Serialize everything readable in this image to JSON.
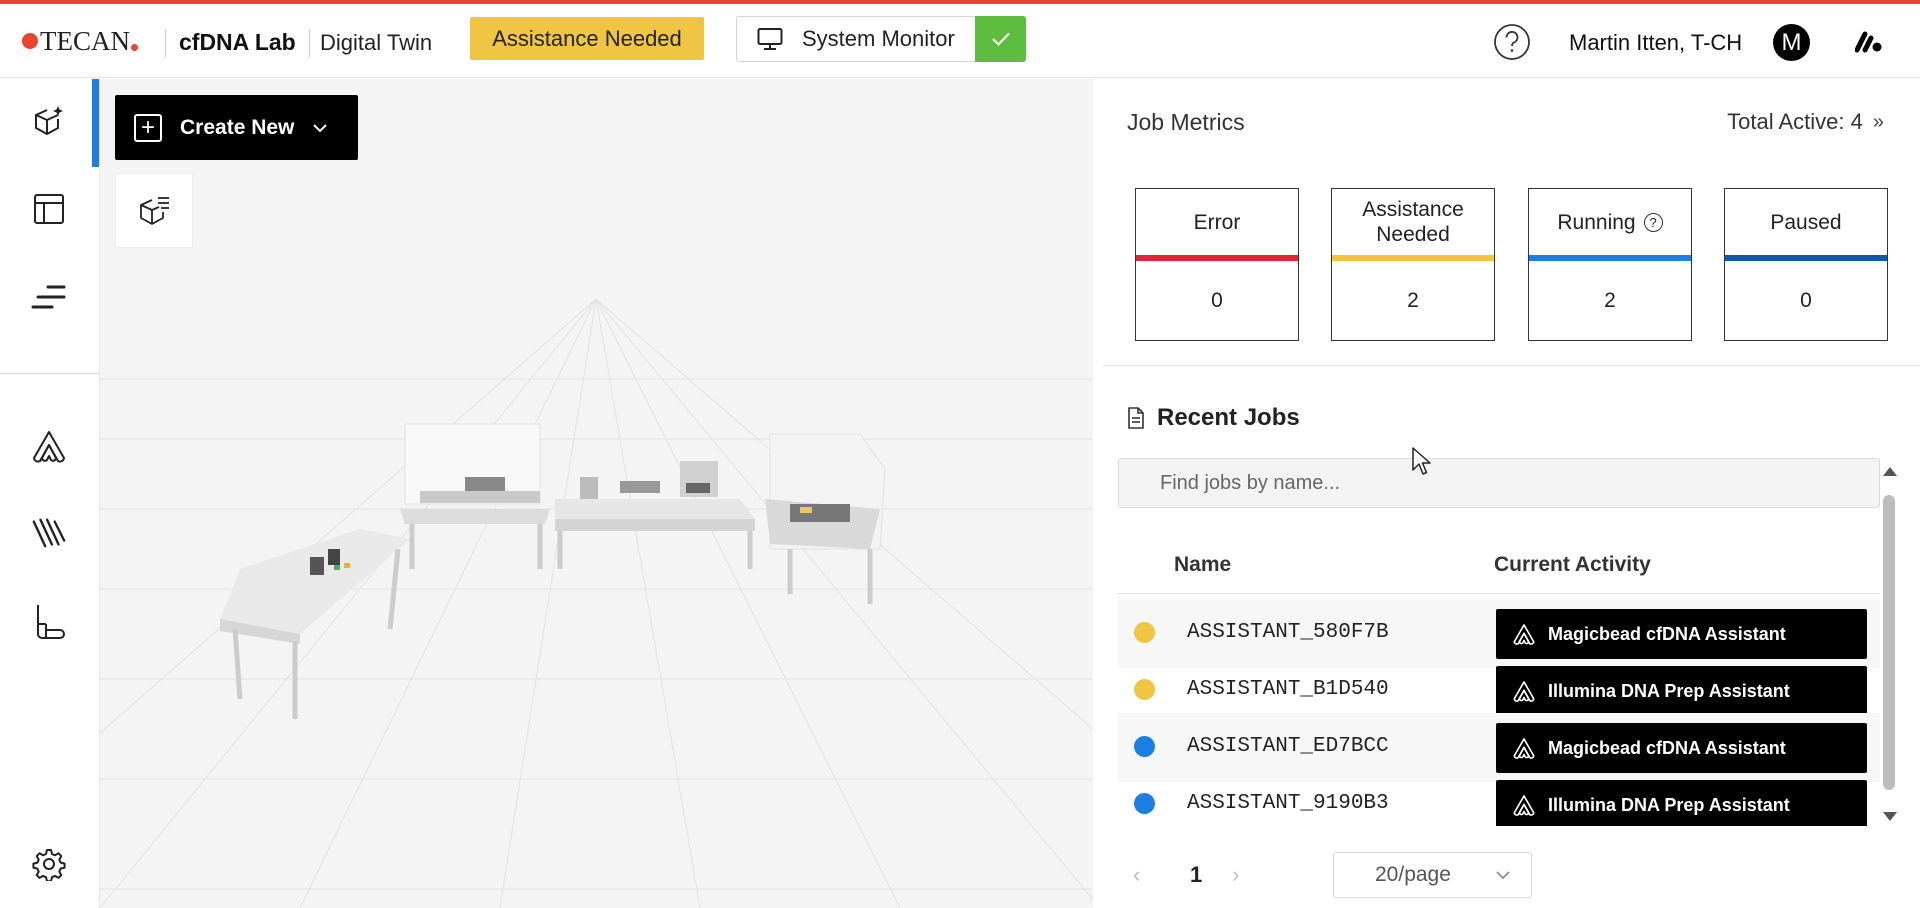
{
  "header": {
    "logo_text": "TECAN",
    "app_name": "cfDNA Lab",
    "app_sub": "Digital Twin",
    "status_badge": "Assistance Needed",
    "system_monitor_label": "System Monitor",
    "user_name": "Martin Itten, T-CH",
    "avatar_initial": "M"
  },
  "sidebar": {
    "items": [
      {
        "icon": "cube-sparkle-icon",
        "active": true
      },
      {
        "icon": "layout-icon",
        "active": false
      },
      {
        "icon": "timeline-icon",
        "active": false
      },
      {
        "icon": "assistant-icon",
        "active": false
      },
      {
        "icon": "pipettes-icon",
        "active": false
      },
      {
        "icon": "labware-icon",
        "active": false
      }
    ],
    "settings_icon": "gear-icon"
  },
  "viewport": {
    "create_label": "Create New"
  },
  "metrics": {
    "title": "Job Metrics",
    "total_active": "Total Active: 4",
    "cards": [
      {
        "label": "Error",
        "value": "0",
        "color": "#e0273a"
      },
      {
        "label": "Assistance Needed",
        "value": "2",
        "color": "#f0c541"
      },
      {
        "label": "Running",
        "value": "2",
        "color": "#1a7fe0"
      },
      {
        "label": "Paused",
        "value": "0",
        "color": "#1159a8"
      }
    ]
  },
  "recent_jobs": {
    "title": "Recent Jobs",
    "search_placeholder": "Find jobs by name...",
    "columns": {
      "name": "Name",
      "activity": "Current Activity"
    },
    "rows": [
      {
        "name": "ASSISTANT_580F7B",
        "status_color": "#f0c541",
        "activity": "Magicbead cfDNA Assistant"
      },
      {
        "name": "ASSISTANT_B1D540",
        "status_color": "#f0c541",
        "activity": "Illumina DNA Prep Assistant"
      },
      {
        "name": "ASSISTANT_ED7BCC",
        "status_color": "#1a7fe0",
        "activity": "Magicbead cfDNA Assistant"
      },
      {
        "name": "ASSISTANT_9190B3",
        "status_color": "#1a7fe0",
        "activity": "Illumina DNA Prep Assistant"
      }
    ],
    "pagination": {
      "page": "1",
      "page_size": "20/page"
    }
  }
}
